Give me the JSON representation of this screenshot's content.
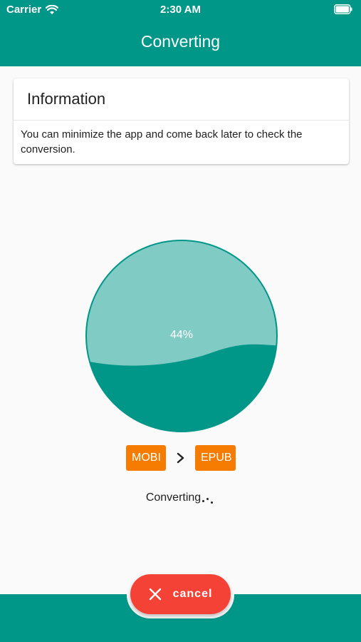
{
  "status_bar": {
    "carrier": "Carrier",
    "time": "2:30 AM"
  },
  "app_bar": {
    "title": "Converting"
  },
  "info_card": {
    "title": "Information",
    "text": "You can minimize the app and come back later to check the conversion."
  },
  "progress": {
    "percent": 44,
    "label": "44%"
  },
  "formats": {
    "from": "MOBI",
    "to": "EPUB"
  },
  "status": {
    "text": "Converting"
  },
  "actions": {
    "cancel_label": "cancel"
  },
  "colors": {
    "primary": "#009688",
    "primary_light": "#80cbc4",
    "chip": "#f57c00",
    "cancel": "#f44336"
  },
  "icons": {
    "wifi": "wifi-icon",
    "battery": "battery-icon",
    "arrow": "chevron-right-icon",
    "cancel": "close-icon"
  }
}
